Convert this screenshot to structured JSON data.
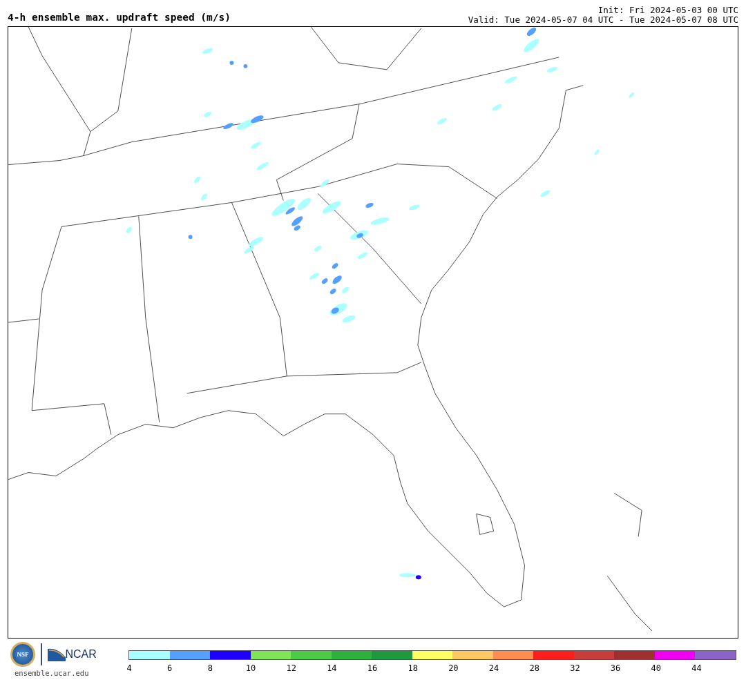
{
  "title": "4-h ensemble max. updraft speed (m/s)",
  "init": "Init: Fri 2024-05-03 00 UTC",
  "valid": "Valid: Tue 2024-05-07 04 UTC - Tue 2024-05-07 08 UTC",
  "logos": {
    "nsf": "NSF",
    "ncar": "NCAR",
    "url": "ensemble.ucar.edu"
  },
  "colorbar": {
    "segments": [
      {
        "color": "#aaffff"
      },
      {
        "color": "#55a0ff"
      },
      {
        "color": "#1e00ff"
      },
      {
        "color": "#80e35a"
      },
      {
        "color": "#4ccb46"
      },
      {
        "color": "#2eb03c"
      },
      {
        "color": "#1e9a3c"
      },
      {
        "color": "#ffff64"
      },
      {
        "color": "#ffc864"
      },
      {
        "color": "#ff8c50"
      },
      {
        "color": "#ff1e1e"
      },
      {
        "color": "#c83c3c"
      },
      {
        "color": "#a03030"
      },
      {
        "color": "#f000f0"
      },
      {
        "color": "#8c64c8"
      }
    ],
    "ticks": [
      "4",
      "6",
      "8",
      "10",
      "12",
      "14",
      "16",
      "18",
      "20",
      "24",
      "28",
      "32",
      "36",
      "40",
      "44"
    ]
  }
}
